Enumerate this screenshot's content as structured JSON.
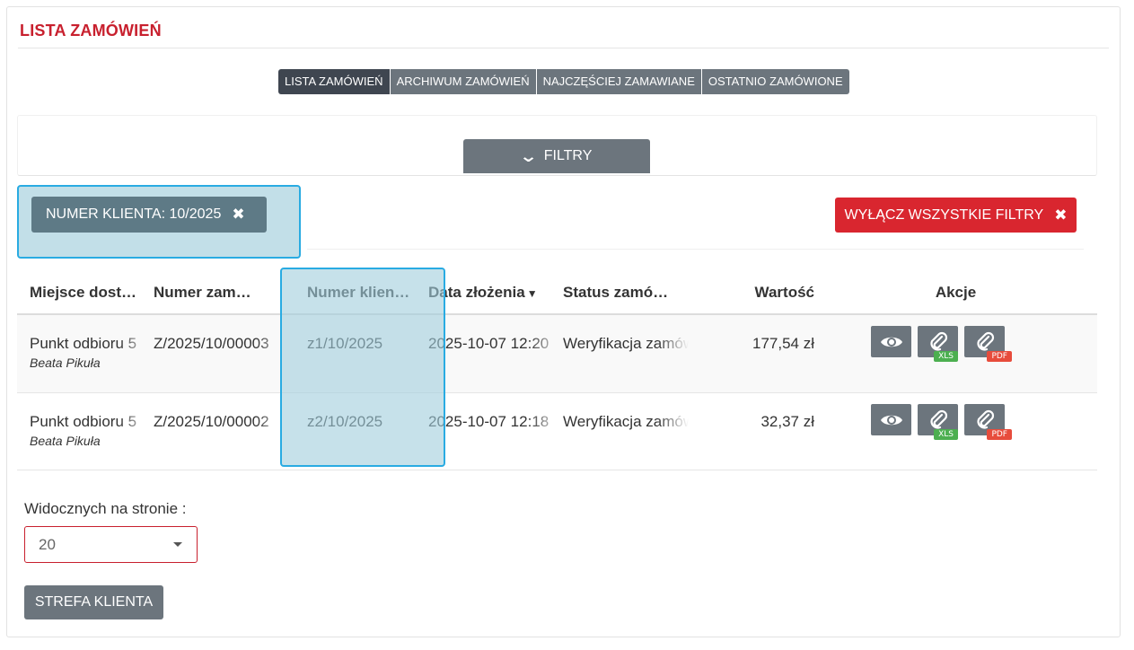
{
  "page": {
    "title": "LISTA ZAMÓWIEŃ"
  },
  "tabs": [
    {
      "label": "LISTA ZAMÓWIEŃ",
      "active": true
    },
    {
      "label": "ARCHIWUM ZAMÓWIEŃ",
      "active": false
    },
    {
      "label": "NAJCZĘŚCIEJ ZAMAWIANE",
      "active": false
    },
    {
      "label": "OSTATNIO ZAMÓWIONE",
      "active": false
    }
  ],
  "filters": {
    "toggle_label": "FILTRY",
    "toggle_icon": "chevron-down-icon",
    "active_filter": "NUMER KLIENTA: 10/2025",
    "remove_icon": "close-icon",
    "clear_all_label": "WYŁĄCZ WSZYSTKIE FILTRY"
  },
  "table": {
    "headers": [
      "Miejsce dost…",
      "Numer zam…",
      "Numer klien…",
      "Data złożenia",
      "Status zamó…",
      "Wartość",
      "Akcje"
    ],
    "sorted_column": "Data złożenia",
    "sort_direction": "descending",
    "rows": [
      {
        "place": "Punkt odbioru 5",
        "person": "Beata Pikuła",
        "order_no": "Z/2025/10/00003",
        "client_no": "z1/10/2025",
        "date": "2025-10-07 12:20",
        "status": "Weryfikacja zamówienia",
        "value": "177,54 zł"
      },
      {
        "place": "Punkt odbioru 5",
        "person": "Beata Pikuła",
        "order_no": "Z/2025/10/00002",
        "client_no": "z2/10/2025",
        "date": "2025-10-07 12:18",
        "status": "Weryfikacja zamówienia",
        "value": "32,37 zł"
      }
    ],
    "action_badges": {
      "xls": "XLS",
      "pdf": "PDF"
    }
  },
  "pagination": {
    "label": "Widocznych na stronie :",
    "per_page": "20"
  },
  "footer": {
    "button_label": "STREFA KLIENTA"
  },
  "colors": {
    "accent_red": "#c8202e",
    "button_gray": "#6c757d",
    "highlight_blue": "#29abe2"
  }
}
